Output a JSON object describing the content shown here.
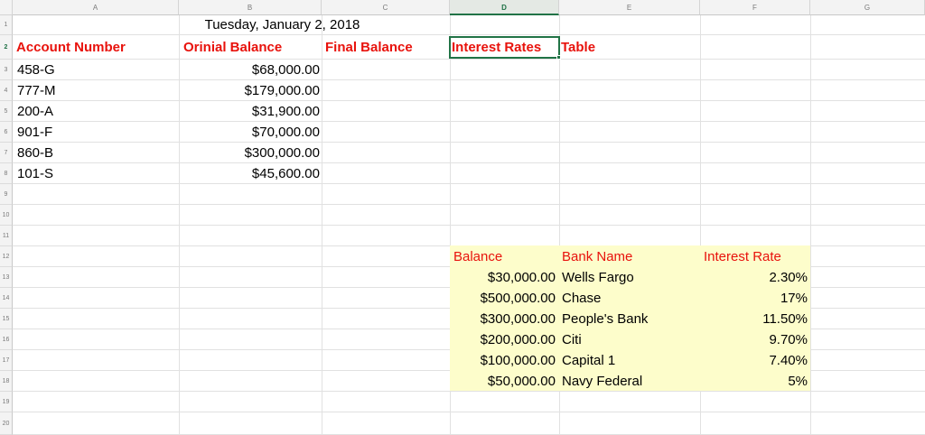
{
  "columns": [
    "A",
    "B",
    "C",
    "D",
    "E",
    "F",
    "G"
  ],
  "rows": [
    "1",
    "2",
    "3",
    "4",
    "5",
    "6",
    "7",
    "8",
    "9",
    "10",
    "11",
    "12",
    "13",
    "14",
    "15",
    "16",
    "17",
    "18",
    "19",
    "20"
  ],
  "active_column": "D",
  "active_row": "2",
  "date_title": "Tuesday, January 2, 2018",
  "headers": {
    "account_number": "Account Number",
    "original_balance": "Orinial Balance",
    "final_balance": "Final Balance",
    "interest_rates": "Interest Rates",
    "table": "Table"
  },
  "accounts": [
    {
      "account": "458-G",
      "balance": "$68,000.00"
    },
    {
      "account": "777-M",
      "balance": "$179,000.00"
    },
    {
      "account": "200-A",
      "balance": "$31,900.00"
    },
    {
      "account": "901-F",
      "balance": "$70,000.00"
    },
    {
      "account": "860-B",
      "balance": "$300,000.00"
    },
    {
      "account": "101-S",
      "balance": "$45,600.00"
    }
  ],
  "rates_table": {
    "headers": {
      "balance": "Balance",
      "bank": "Bank Name",
      "rate": "Interest Rate"
    },
    "rows": [
      {
        "balance": "$30,000.00",
        "bank": "Wells Fargo",
        "rate": "2.30%"
      },
      {
        "balance": "$500,000.00",
        "bank": "Chase",
        "rate": "17%"
      },
      {
        "balance": "$300,000.00",
        "bank": "People's Bank",
        "rate": "11.50%"
      },
      {
        "balance": "$200,000.00",
        "bank": "Citi",
        "rate": "9.70%"
      },
      {
        "balance": "$100,000.00",
        "bank": "Capital 1",
        "rate": "7.40%"
      },
      {
        "balance": "$50,000.00",
        "bank": "Navy Federal",
        "rate": "5%"
      }
    ]
  },
  "colors": {
    "header_red": "#e8120c",
    "selection_green": "#217346",
    "table_fill": "#fdfdcb"
  }
}
